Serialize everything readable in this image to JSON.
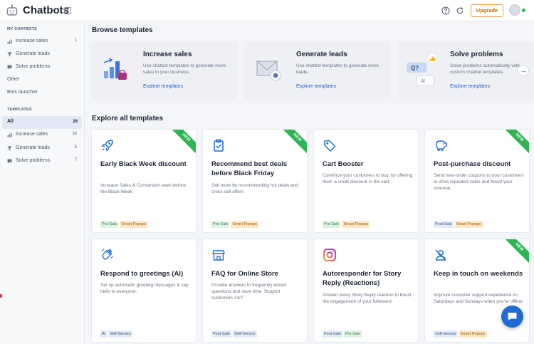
{
  "header": {
    "title": "Chatbots",
    "help_badge": "?",
    "upgrade_label": "Upgrade",
    "icons": [
      "robot-logo-icon",
      "help-circle-icon",
      "refresh-icon"
    ]
  },
  "sidebar": {
    "my_chatbots_heading": "MY CHATBOTS",
    "my_chatbots": [
      {
        "label": "Increase sales",
        "count": "1",
        "icon": "chart-icon"
      },
      {
        "label": "Generate leads",
        "count": "",
        "icon": "funnel-icon"
      },
      {
        "label": "Solve problems",
        "count": "",
        "icon": "chat-icon"
      }
    ],
    "other_label": "Other",
    "bots_launcher_label": "Bots launcher",
    "templates_heading": "TEMPLATES",
    "templates": [
      {
        "label": "All",
        "count": "26"
      },
      {
        "label": "Increase sales",
        "count": "14",
        "icon": "chart-icon"
      },
      {
        "label": "Generate leads",
        "count": "5",
        "icon": "funnel-icon"
      },
      {
        "label": "Solve problems",
        "count": "7",
        "icon": "chat-icon"
      }
    ]
  },
  "browse": {
    "title": "Browse templates",
    "cards": [
      {
        "title": "Increase sales",
        "desc": "Use chatbot templates to generate more sales in your business.",
        "link": "Explore templates"
      },
      {
        "title": "Generate leads",
        "desc": "Use chatbot templates to generate more leads.",
        "link": "Explore templates"
      },
      {
        "title": "Solve problems",
        "desc": "Solve problems automatically with custom chatbot templates.",
        "link": "Explore templates"
      }
    ]
  },
  "explore": {
    "title": "Explore all templates",
    "new_badge": "NEW",
    "cards": [
      {
        "title": "Early Black Week discount",
        "desc": "Increase Sales & Conversion even before the Black Week",
        "tags": [
          "Pre-Sale",
          "Smart Popups"
        ],
        "is_new": true,
        "icon": "rocket-icon"
      },
      {
        "title": "Recommend best deals before Black Friday",
        "desc": "Sell more by recommending hot deals and cross-sell offers",
        "tags": [
          "Pre-Sale",
          "Smart Popups"
        ],
        "is_new": true,
        "icon": "clipboard-check-icon"
      },
      {
        "title": "Cart Booster",
        "desc": "Convince your customers to buy, by offering them a small discount in the cart.",
        "tags": [
          "Pre-Sale",
          "Smart Popups"
        ],
        "is_new": false,
        "icon": "tag-icon"
      },
      {
        "title": "Post-purchase discount",
        "desc": "Send next-order coupons to your customers to drive repeated sales and boost your revenue.",
        "tags": [
          "Post-Sale",
          "Smart Popups"
        ],
        "is_new": true,
        "icon": "piggy-bank-icon"
      },
      {
        "title": "Respond to greetings (AI)",
        "desc": "Set up automatic greeting messages & say hello to everyone.",
        "tags": [
          "AI",
          "Self-Service"
        ],
        "is_new": false,
        "icon": "waving-hand-icon"
      },
      {
        "title": "FAQ for Online Store",
        "desc": "Provide answers to frequently asked questions and save time. Support customers 24/7",
        "tags": [
          "Post-Sale",
          "Self-Service"
        ],
        "is_new": false,
        "icon": "store-icon"
      },
      {
        "title": "Autoresponder for Story Reply (Reactions)",
        "desc": "Answer every Story Reply reaction to boost the engagement of your followers!",
        "tags": [
          "Post-Sale",
          "Pre-Sale"
        ],
        "is_new": false,
        "icon": "instagram-icon"
      },
      {
        "title": "Keep in touch on weekends",
        "desc": "Improve customer support experience on Saturdays and Sundays when you're offline.",
        "tags": [
          "Self-Service",
          "Smart Popups"
        ],
        "is_new": true,
        "icon": "user-off-icon"
      }
    ]
  },
  "colors": {
    "accent": "#2860c8",
    "new_badge": "#2fb453",
    "upgrade_border": "#f0a030",
    "fab": "#1f6bd6"
  }
}
